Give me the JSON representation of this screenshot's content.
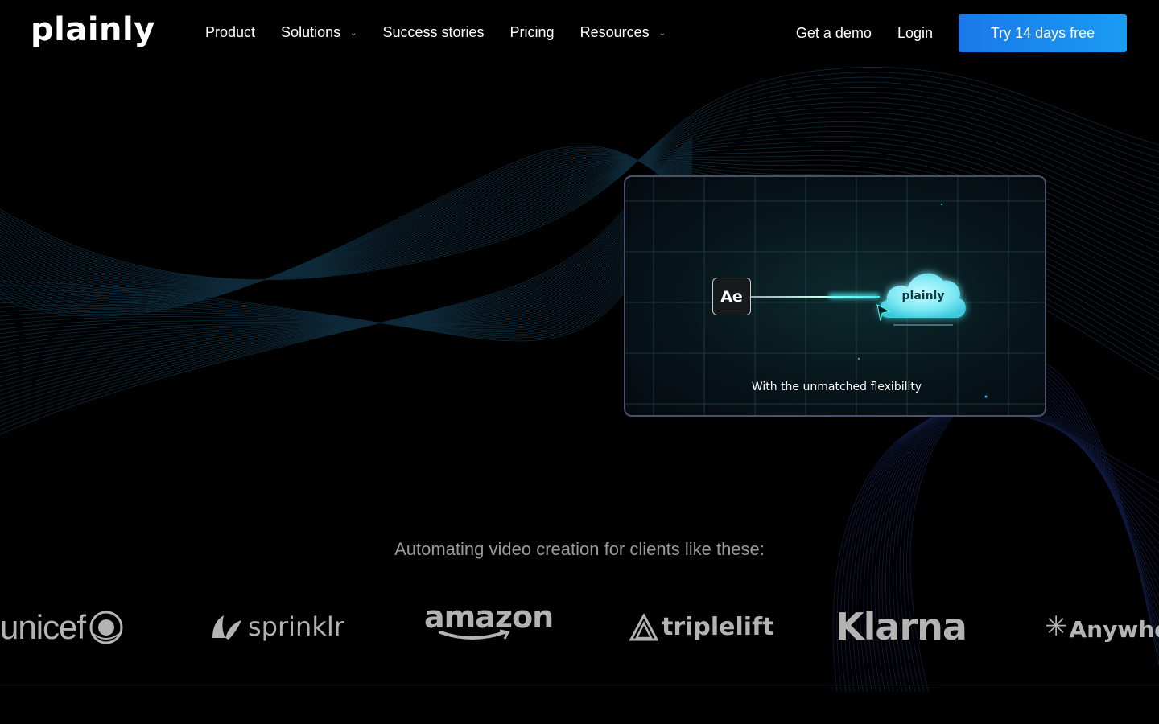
{
  "header": {
    "logo": "plainly",
    "nav": [
      {
        "label": "Product",
        "has_dropdown": false
      },
      {
        "label": "Solutions",
        "has_dropdown": true
      },
      {
        "label": "Success stories",
        "has_dropdown": false
      },
      {
        "label": "Pricing",
        "has_dropdown": false
      },
      {
        "label": "Resources",
        "has_dropdown": true
      }
    ],
    "get_demo": "Get a demo",
    "login": "Login",
    "cta": "Try 14 days free"
  },
  "video_card": {
    "ae_label": "Ae",
    "cloud_label": "plainly",
    "caption": "With the unmatched flexibility"
  },
  "clients": {
    "heading": "Automating video creation for clients like these:",
    "logos": [
      "unicef",
      "sprinklr",
      "amazon",
      "triplelift",
      "Klarna",
      "Anywher"
    ]
  },
  "colors": {
    "background": "#000000",
    "cta_start": "#1a78ea",
    "cta_end": "#1a9cf2",
    "cloud": "#7fe9f5",
    "logo_gray": "#b3b3b3",
    "card_border": "#4a4f6a"
  }
}
